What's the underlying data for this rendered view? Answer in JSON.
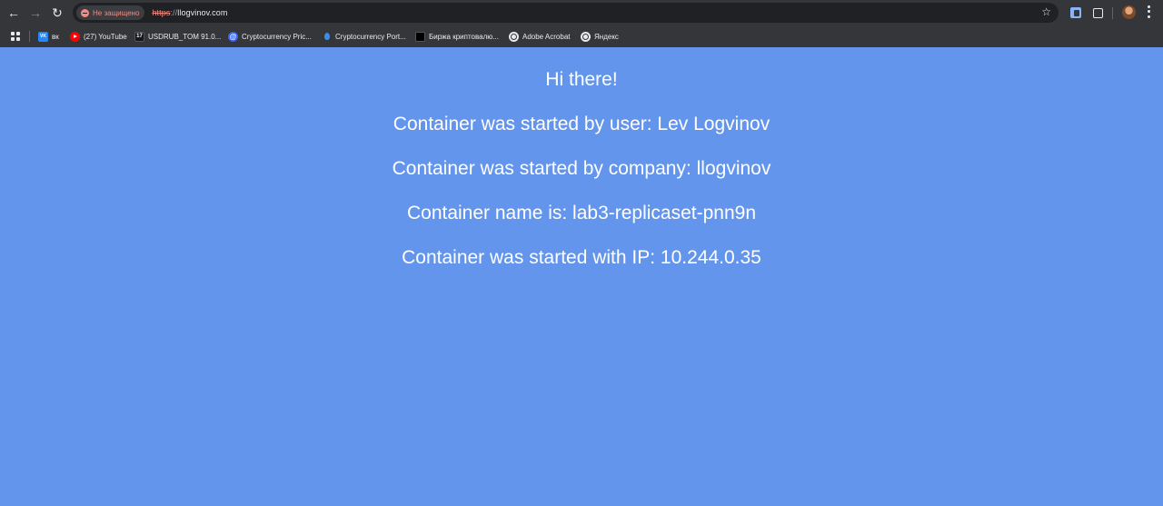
{
  "browser": {
    "security_label": "Не защищено",
    "url_scheme": "https",
    "url_separator": "://",
    "url_host": "llogvinov.com"
  },
  "bookmarks": [
    {
      "label": "вк",
      "icon": "vk-icon"
    },
    {
      "label": "(27) YouTube",
      "icon": "youtube-icon"
    },
    {
      "label": "USDRUB_TOM 91.0...",
      "icon": "tradingview-icon"
    },
    {
      "label": "Cryptocurrency Pric...",
      "icon": "coinmarketcap-icon"
    },
    {
      "label": "Cryptocurrency Port...",
      "icon": "droplet-icon"
    },
    {
      "label": "Биржа криптовалю...",
      "icon": "exchange-icon"
    },
    {
      "label": "Adobe Acrobat",
      "icon": "globe-icon"
    },
    {
      "label": "Яндекс",
      "icon": "globe-icon"
    }
  ],
  "page": {
    "greeting": "Hi there!",
    "user_line": "Container was started by user: Lev Logvinov",
    "company_line": "Container was started by company: llogvinov",
    "name_line": "Container name is: lab3-replicaset-pnn9n",
    "ip_line": "Container was started with IP: 10.244.0.35"
  },
  "colors": {
    "page_background": "#6495ED",
    "page_text": "#ffffff",
    "chrome_background": "#35363a",
    "omnibox_background": "#202124",
    "insecure_warning": "#f28b82"
  }
}
